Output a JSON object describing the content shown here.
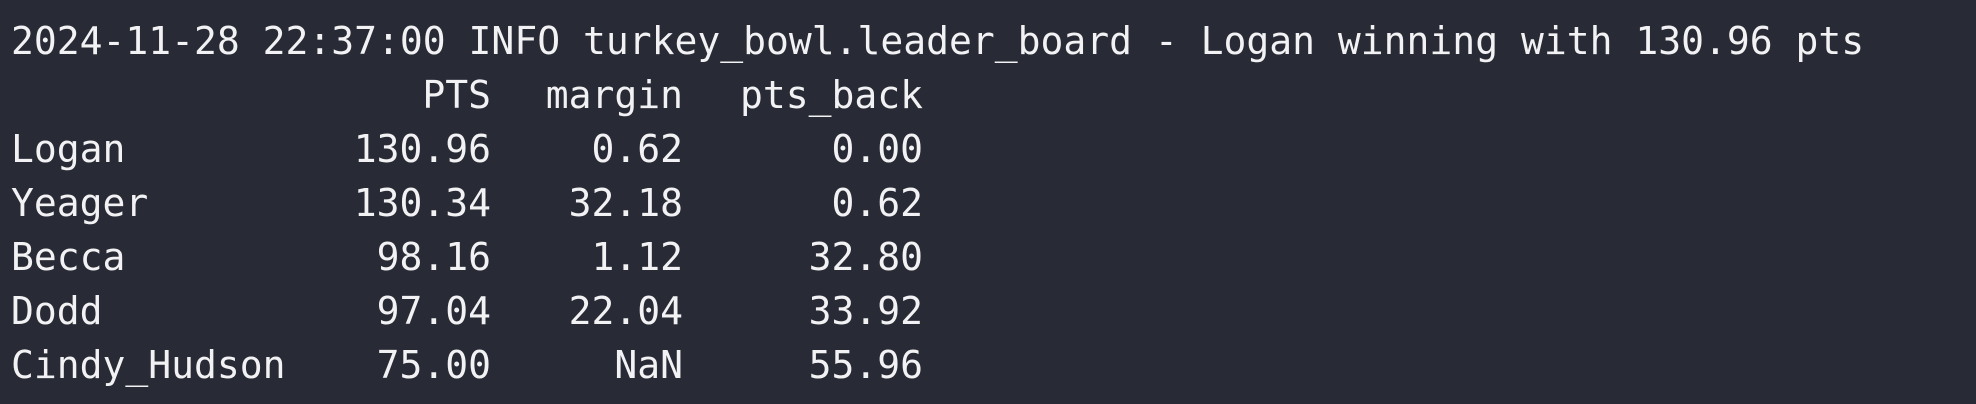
{
  "log": {
    "line": "2024-11-28 22:37:00 INFO turkey_bowl.leader_board - Logan winning with 130.96 pts"
  },
  "table": {
    "columns": [
      "PTS",
      "margin",
      "pts_back"
    ],
    "rows": [
      {
        "name": "Logan",
        "pts": "130.96",
        "margin": "0.62",
        "pts_back": "0.00"
      },
      {
        "name": "Yeager",
        "pts": "130.34",
        "margin": "32.18",
        "pts_back": "0.62"
      },
      {
        "name": "Becca",
        "pts": "98.16",
        "margin": "1.12",
        "pts_back": "32.80"
      },
      {
        "name": "Dodd",
        "pts": "97.04",
        "margin": "22.04",
        "pts_back": "33.92"
      },
      {
        "name": "Cindy_Hudson",
        "pts": "75.00",
        "margin": "NaN",
        "pts_back": "55.96"
      }
    ]
  },
  "colors": {
    "background": "#282b35",
    "text": "#f2f2f4"
  }
}
